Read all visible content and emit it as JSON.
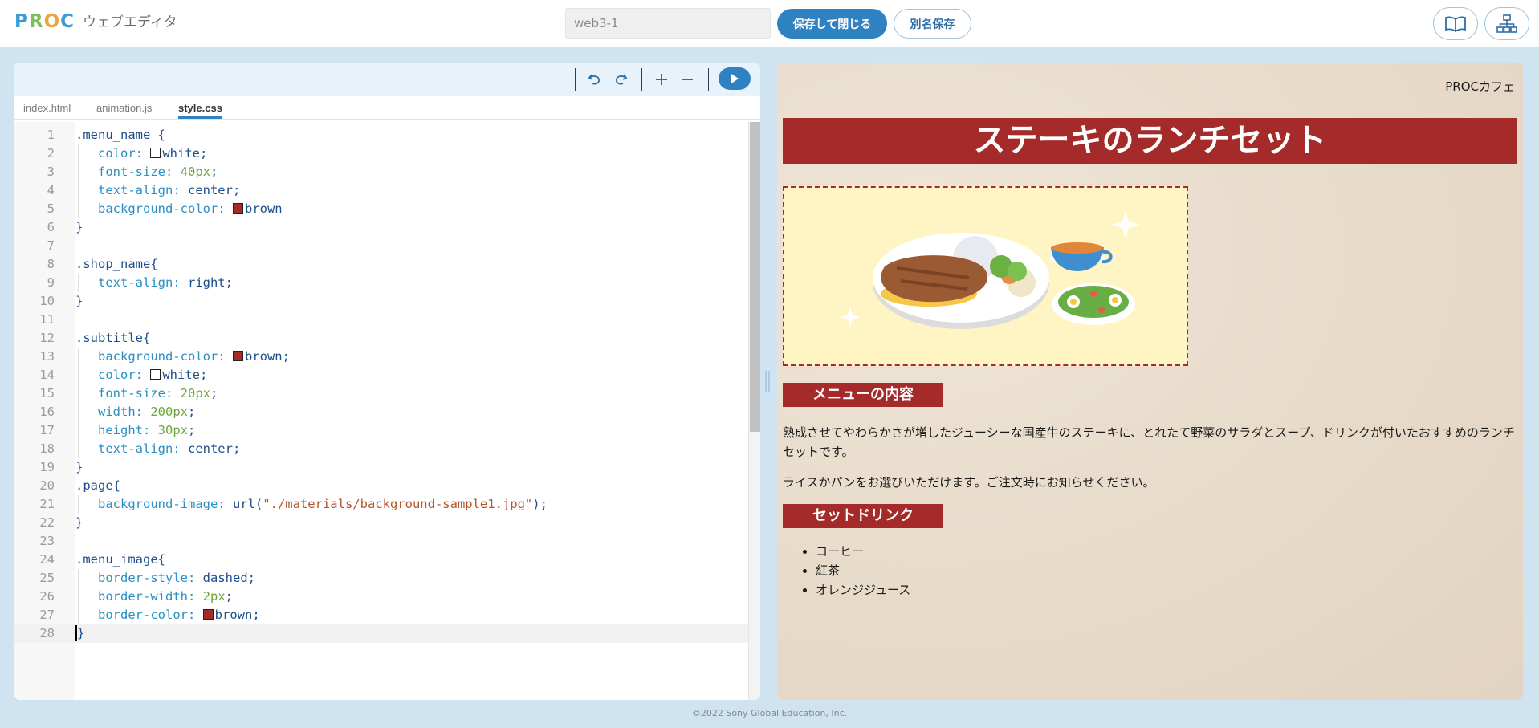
{
  "header": {
    "logo": {
      "p": "P",
      "r": "R",
      "o": "O",
      "c": "C"
    },
    "app_title": "ウェブエディタ",
    "project_name": "web3-1",
    "save_close_label": "保存して閉じる",
    "save_as_label": "別名保存"
  },
  "editor": {
    "tabs": [
      {
        "label": "index.html"
      },
      {
        "label": "animation.js"
      },
      {
        "label": "style.css"
      }
    ],
    "active_tab": "style.css",
    "lines": [
      {
        "n": "1",
        "sel": ".menu_name",
        "brace": " {"
      },
      {
        "n": "2",
        "prop": "color:",
        "val": "white",
        "end": ";"
      },
      {
        "n": "3",
        "prop": "font-size:",
        "num": "40px",
        "end": ";"
      },
      {
        "n": "4",
        "prop": "text-align:",
        "val": "center",
        "end": ";"
      },
      {
        "n": "5",
        "prop": "background-color:",
        "val": "brown",
        "end": ""
      },
      {
        "n": "6",
        "close": "}"
      },
      {
        "n": "7"
      },
      {
        "n": "8",
        "sel": ".shop_name",
        "brace": "{"
      },
      {
        "n": "9",
        "prop": "text-align:",
        "val": "right",
        "end": ";"
      },
      {
        "n": "10",
        "close": "}"
      },
      {
        "n": "11"
      },
      {
        "n": "12",
        "sel": ".subtitle",
        "brace": "{"
      },
      {
        "n": "13",
        "prop": "background-color:",
        "val": "brown",
        "end": ";"
      },
      {
        "n": "14",
        "prop": "color:",
        "val": "white",
        "end": ";"
      },
      {
        "n": "15",
        "prop": "font-size:",
        "num": "20px",
        "end": ";"
      },
      {
        "n": "16",
        "prop": "width:",
        "num": "200px",
        "end": ";"
      },
      {
        "n": "17",
        "prop": "height:",
        "num": "30px",
        "end": ";"
      },
      {
        "n": "18",
        "prop": "text-align:",
        "val": "center",
        "end": ";"
      },
      {
        "n": "19",
        "close": "}"
      },
      {
        "n": "20",
        "sel": ".page",
        "brace": "{"
      },
      {
        "n": "21",
        "prop": "background-image:",
        "fn": "url(",
        "str": "\"./materials/background-sample1.jpg\"",
        "end": ");"
      },
      {
        "n": "22",
        "close": "}"
      },
      {
        "n": "23"
      },
      {
        "n": "24",
        "sel": ".menu_image",
        "brace": "{"
      },
      {
        "n": "25",
        "prop": "border-style:",
        "val": "dashed",
        "end": ";"
      },
      {
        "n": "26",
        "prop": "border-width:",
        "num": "2px",
        "end": ";"
      },
      {
        "n": "27",
        "prop": "border-color:",
        "val": "brown",
        "end": ";"
      },
      {
        "n": "28",
        "close": "}"
      }
    ]
  },
  "preview": {
    "shop_name": "PROCカフェ",
    "menu_name": "ステーキのランチセット",
    "subtitle_menu": "メニューの内容",
    "description1": "熟成させてやわらかさが増したジューシーな国産牛のステーキに、とれたて野菜のサラダとスープ、ドリンクが付いたおすすめのランチセットです。",
    "description2": "ライスかパンをお選びいただけます。ご注文時にお知らせください。",
    "subtitle_drink": "セットドリンク",
    "drinks": [
      "コーヒー",
      "紅茶",
      "オレンジジュース"
    ]
  },
  "footer": "©2022 Sony Global Education, Inc.",
  "colors": {
    "accent": "#2f82c1",
    "brown": "#a52a2a",
    "image_bg": "#fff4c4"
  }
}
